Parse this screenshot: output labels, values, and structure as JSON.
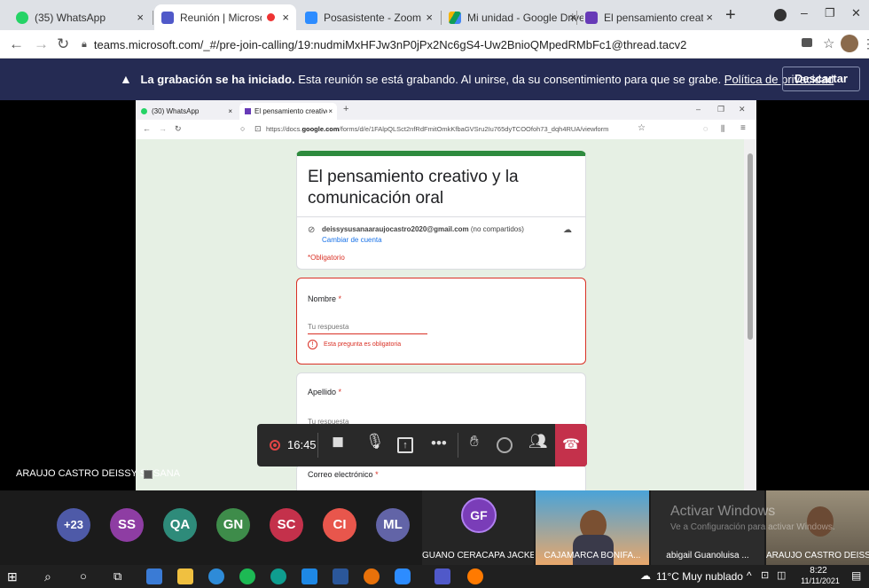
{
  "browser_tabs": [
    {
      "label": "(35) WhatsApp",
      "close": "×",
      "color": "#25d366"
    },
    {
      "label": "Reunión | Microsoft Team",
      "close": "×",
      "color": "#5059c9"
    },
    {
      "label": "Posasistente - Zoom",
      "close": "×",
      "color": "#2d8cff"
    },
    {
      "label": "Mi unidad - Google Drive",
      "close": "×",
      "color": "#f4b400"
    },
    {
      "label": "El pensamiento creativo y la",
      "close": "×",
      "color": "#673ab7"
    }
  ],
  "new_tab": "+",
  "window_controls": {
    "minimize": "–",
    "restore": "❐",
    "close": "✕"
  },
  "url": "teams.microsoft.com/_#/pre-join-calling/19:nudmiMxHFJw3nP0jPx2Nc6gS4-Uw2BnioQMpedRMbFc1@thread.tacv2",
  "banner": {
    "bold": "La grabación se ha iniciado.",
    "text": " Esta reunión se está grabando. Al unirse, da su consentimiento para que se grabe. ",
    "link": "Política de privacidad",
    "button": "Descartar"
  },
  "shared": {
    "tabs": [
      "(30) WhatsApp",
      "El pensamiento creativo y la co"
    ],
    "url_prefix": "https://docs.",
    "url_domain": "google.com",
    "url_rest": "/forms/d/e/1FAlpQLSct2nfRdFmitOmkKfbaGVSru2Iu765dyTCOOfoh73_dqh4RUA/viewform",
    "form_title": "El pensamiento creativo y la comunicación oral",
    "email": "deissysusanaaraujocastro2020@gmail.com",
    "not_shared": " (no compartidos)",
    "switch_account": "Cambiar de cuenta",
    "required_note": "*Obligatorio",
    "q1": {
      "label": "Nombre",
      "placeholder": "Tu respuesta",
      "error": "Esta pregunta es obligatoria"
    },
    "q2": {
      "label": "Apellido",
      "placeholder": "Tu respuesta"
    },
    "q3": {
      "label": "Correo electrónico"
    },
    "asterisk": "*"
  },
  "presenter_name": "ARAUJO CASTRO DEISSY SUSANA",
  "call": {
    "timer": "16:45"
  },
  "overflow_count": "+23",
  "participants": [
    {
      "initials": "SS",
      "color": "#8e3da3"
    },
    {
      "initials": "QA",
      "color": "#2e8b7a"
    },
    {
      "initials": "GN",
      "color": "#3e8c4a"
    },
    {
      "initials": "SC",
      "color": "#c4314b"
    },
    {
      "initials": "CI",
      "color": "#e8564c"
    },
    {
      "initials": "ML",
      "color": "#6264a7"
    }
  ],
  "tiles": [
    {
      "name": "GUANO CERACAPA JACKE...",
      "initials": "GF"
    },
    {
      "name": "CAJAMARCA BONIFA..."
    },
    {
      "name": "abigail Guanoluisa ..."
    },
    {
      "name": "ARAUJO CASTRO DEISSY..."
    }
  ],
  "watermark": {
    "title": "Activar Windows",
    "sub": "Ve a Configuración para activar Windows."
  },
  "taskbar": {
    "weather": "11°C  Muy nublado",
    "time": "8:22",
    "date": "11/11/2021"
  }
}
